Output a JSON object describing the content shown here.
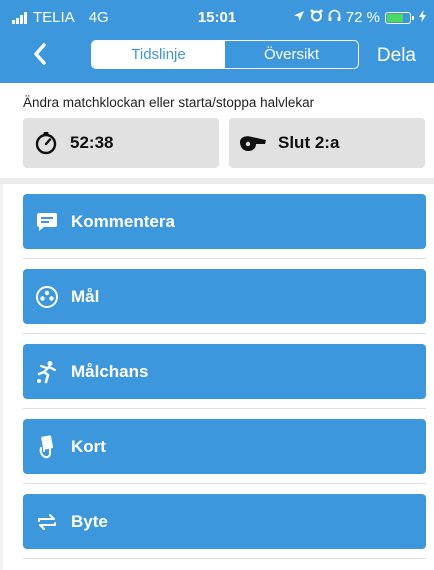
{
  "status_bar": {
    "carrier": "TELIA",
    "network": "4G",
    "time": "15:01",
    "battery": "72 %",
    "battery_level": 0.72,
    "icons": [
      "signal-icon",
      "location-icon",
      "alarm-icon",
      "headphones-icon",
      "battery-icon",
      "charging-icon"
    ]
  },
  "nav": {
    "back_icon": "chevron-left-icon",
    "tabs": [
      {
        "label": "Tidslinje",
        "active": true
      },
      {
        "label": "Översikt",
        "active": false
      }
    ],
    "share_label": "Dela"
  },
  "clock": {
    "hint": "Ändra matchklockan eller starta/stoppa halvlekar",
    "timer_icon": "stopwatch-icon",
    "timer_value": "52:38",
    "period_icon": "whistle-icon",
    "period_label": "Slut 2:a"
  },
  "actions": [
    {
      "label": "Kommentera",
      "icon": "comment-icon"
    },
    {
      "label": "Mål",
      "icon": "ball-icon"
    },
    {
      "label": "Målchans",
      "icon": "kicking-player-icon"
    },
    {
      "label": "Kort",
      "icon": "card-hand-icon"
    },
    {
      "label": "Byte",
      "icon": "swap-icon"
    }
  ],
  "colors": {
    "accent": "#3d97dc",
    "card_bg": "#e1e1e1",
    "battery_green": "#4cd964"
  }
}
